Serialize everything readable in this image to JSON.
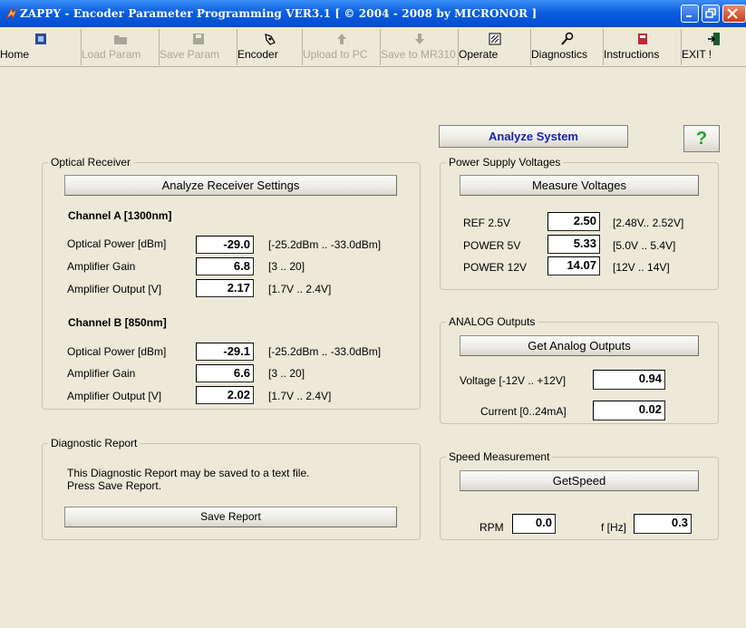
{
  "window": {
    "title": "ZAPPY - Encoder Parameter Programming  VER3.1 [ © 2004 - 2008 by MICRONOR ]"
  },
  "toolbar": [
    {
      "label": "Home",
      "icon": "home-icon",
      "enabled": true
    },
    {
      "label": "Load Param",
      "icon": "folder-icon",
      "enabled": false
    },
    {
      "label": "Save Param",
      "icon": "floppy-icon",
      "enabled": false
    },
    {
      "label": "Encoder",
      "icon": "encoder-icon",
      "enabled": true
    },
    {
      "label": "Upload to PC",
      "icon": "up-arrow-icon",
      "enabled": false
    },
    {
      "label": "Save to MR310",
      "icon": "down-arrow-icon",
      "enabled": false
    },
    {
      "label": "Operate",
      "icon": "operate-icon",
      "enabled": true
    },
    {
      "label": "Diagnostics",
      "icon": "wrench-icon",
      "enabled": true
    },
    {
      "label": "Instructions",
      "icon": "book-icon",
      "enabled": true
    },
    {
      "label": "EXIT !",
      "icon": "exit-door-icon",
      "enabled": true
    }
  ],
  "analyze_system": {
    "label": "Analyze System",
    "help_label": "?"
  },
  "optical_receiver": {
    "legend": "Optical Receiver",
    "analyze_button": "Analyze Receiver Settings",
    "channel_a": {
      "title": "Channel A [1300nm]",
      "rows": [
        {
          "label": "Optical Power [dBm]",
          "value": "-29.0",
          "range": "[-25.2dBm .. -33.0dBm]"
        },
        {
          "label": "Amplifier Gain",
          "value": "6.8",
          "range": "[3 .. 20]"
        },
        {
          "label": "Amplifier Output [V]",
          "value": "2.17",
          "range": "[1.7V .. 2.4V]"
        }
      ]
    },
    "channel_b": {
      "title": "Channel B [850nm]",
      "rows": [
        {
          "label": "Optical Power [dBm]",
          "value": "-29.1",
          "range": "[-25.2dBm .. -33.0dBm]"
        },
        {
          "label": "Amplifier Gain",
          "value": "6.6",
          "range": "[3 .. 20]"
        },
        {
          "label": "Amplifier Output [V]",
          "value": "2.02",
          "range": "[1.7V .. 2.4V]"
        }
      ]
    }
  },
  "diagnostic_report": {
    "legend": "Diagnostic Report",
    "text_line1": "This Diagnostic Report may be saved to a text file.",
    "text_line2": "Press Save Report.",
    "save_button": "Save Report"
  },
  "power_supply": {
    "legend": "Power Supply Voltages",
    "measure_button": "Measure Voltages",
    "rows": [
      {
        "label": "REF 2.5V",
        "value": "2.50",
        "range": "[2.48V.. 2.52V]"
      },
      {
        "label": "POWER 5V",
        "value": "5.33",
        "range": "[5.0V .. 5.4V]"
      },
      {
        "label": "POWER 12V",
        "value": "14.07",
        "range": "[12V .. 14V]"
      }
    ]
  },
  "analog_outputs": {
    "legend": "ANALOG Outputs",
    "get_button": "Get Analog Outputs",
    "voltage_label": "Voltage [-12V .. +12V]",
    "voltage_value": "0.94",
    "current_label": "Current [0..24mA]",
    "current_value": "0.02"
  },
  "speed": {
    "legend": "Speed Measurement",
    "get_button": "GetSpeed",
    "rpm_label": "RPM",
    "rpm_value": "0.0",
    "freq_label": "f [Hz]",
    "freq_value": "0.3"
  },
  "colors": {
    "titlebar": "#0a5fe0",
    "background": "#ece9d8",
    "analyze_text": "#1a23b5",
    "help_green": "#2e9e2e"
  }
}
